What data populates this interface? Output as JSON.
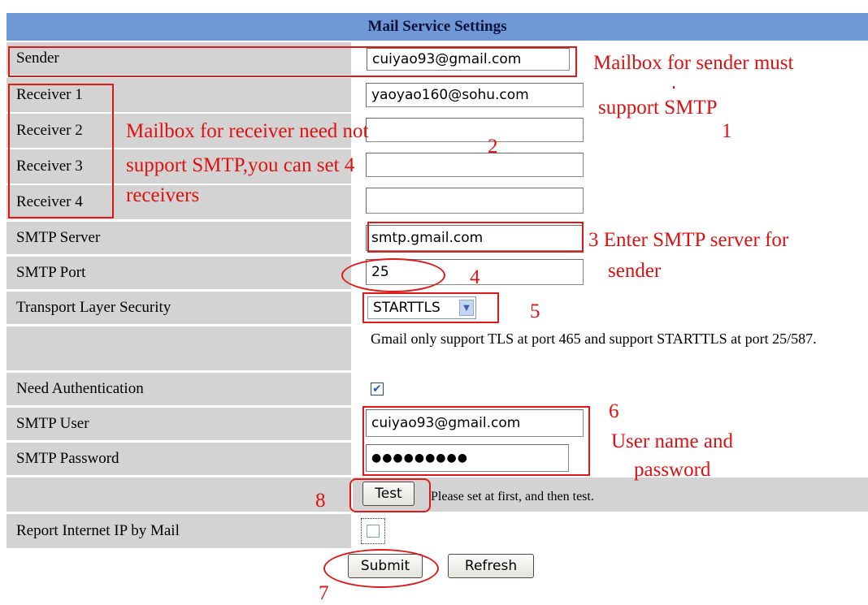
{
  "header": {
    "title": "Mail Service Settings"
  },
  "fields": {
    "sender": {
      "label": "Sender",
      "value": "cuiyao93@gmail.com"
    },
    "receiver1": {
      "label": "Receiver 1",
      "value": "yaoyao160@sohu.com"
    },
    "receiver2": {
      "label": "Receiver 2",
      "value": ""
    },
    "receiver3": {
      "label": "Receiver 3",
      "value": ""
    },
    "receiver4": {
      "label": "Receiver 4",
      "value": ""
    },
    "smtp_server": {
      "label": "SMTP Server",
      "value": "smtp.gmail.com"
    },
    "smtp_port": {
      "label": "SMTP Port",
      "value": "25"
    },
    "tls": {
      "label": "Transport Layer Security",
      "value": "STARTTLS"
    },
    "tls_note": "Gmail only support TLS at port 465 and support STARTTLS at port 25/587.",
    "need_auth": {
      "label": "Need Authentication",
      "checked": true
    },
    "smtp_user": {
      "label": "SMTP User",
      "value": "cuiyao93@gmail.com"
    },
    "smtp_password": {
      "label": "SMTP Password",
      "value": "●●●●●●●●●"
    },
    "test": {
      "label": "Test",
      "note": "Please set at first, and then test."
    },
    "report_ip": {
      "label": "Report Internet IP by Mail",
      "checked": false
    }
  },
  "buttons": {
    "submit": "Submit",
    "refresh": "Refresh"
  },
  "annotations": {
    "a1_line1": "Mailbox for sender must",
    "a1_line2": "support SMTP",
    "a1_num": "1",
    "a2_line1": "Mailbox for receiver need not",
    "a2_line2": "support SMTP,you can set 4",
    "a2_line3": "receivers",
    "a2_num": "2",
    "a3": "3 Enter SMTP server for",
    "a3_line2": "sender",
    "a4": "4",
    "a5": "5",
    "a6": "6",
    "a6_line1": "User name and",
    "a6_line2": "password",
    "a7": "7",
    "a8": "8"
  },
  "colors": {
    "header_bg": "#6f98d5",
    "label_bg": "#d3d3d3",
    "annotation": "#e01010"
  }
}
